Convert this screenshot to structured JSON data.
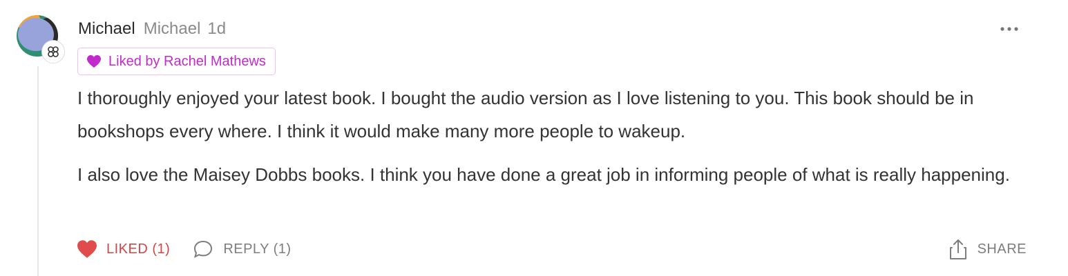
{
  "comment": {
    "author": {
      "name": "Michael",
      "handle": "Michael",
      "avatar_icon": "user-avatar",
      "badge_icon": "clover-badge-icon"
    },
    "timestamp": "1d",
    "liked_by_label": "Liked by Rachel Mathews",
    "paragraphs": [
      "I thoroughly enjoyed your latest book. I bought the audio version as I love listening to you. This book should be in bookshops every where. I think it would make many more people to wakeup.",
      "I also love the Maisey Dobbs books. I think you have done a great job in informing people of what is really happening."
    ],
    "actions": {
      "like_label": "LIKED (1)",
      "reply_label": "REPLY (1)",
      "share_label": "SHARE"
    },
    "colors": {
      "liked_red": "#d24545",
      "liked_by_purple": "#c32acb",
      "muted_gray": "#7d7d7d"
    }
  }
}
